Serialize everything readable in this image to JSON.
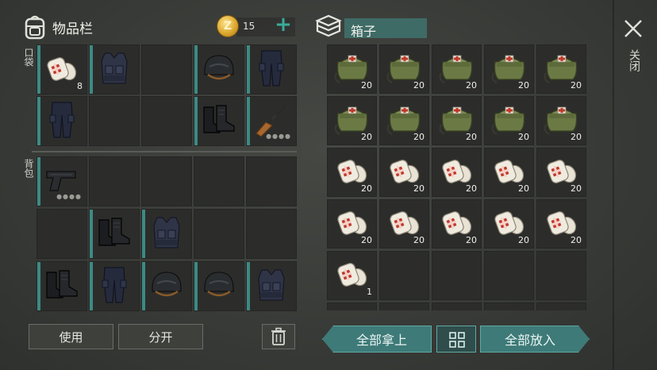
{
  "inventory": {
    "title": "物品栏",
    "coins": "15",
    "coin_symbol": "Z",
    "add_label": "+",
    "pocket_label": "口袋",
    "backpack_label": "背包"
  },
  "box": {
    "title": "箱子"
  },
  "close": {
    "label": "关闭"
  },
  "pocket_slots": [
    {
      "item": "bandage",
      "qty": "8"
    },
    {
      "item": "vest",
      "qty": ""
    },
    {
      "item": "empty",
      "qty": ""
    },
    {
      "item": "helmet",
      "qty": ""
    },
    {
      "item": "pants",
      "qty": ""
    },
    {
      "item": "pants",
      "qty": ""
    },
    {
      "item": "empty",
      "qty": ""
    },
    {
      "item": "empty",
      "qty": ""
    },
    {
      "item": "boots",
      "qty": ""
    },
    {
      "item": "rifle",
      "qty": ""
    }
  ],
  "backpack_slots": [
    {
      "item": "pistol",
      "qty": ""
    },
    {
      "item": "empty",
      "qty": ""
    },
    {
      "item": "empty",
      "qty": ""
    },
    {
      "item": "empty",
      "qty": ""
    },
    {
      "item": "empty",
      "qty": ""
    },
    {
      "item": "empty",
      "qty": ""
    },
    {
      "item": "boots",
      "qty": ""
    },
    {
      "item": "vest",
      "qty": ""
    },
    {
      "item": "empty",
      "qty": ""
    },
    {
      "item": "empty",
      "qty": ""
    },
    {
      "item": "boots",
      "qty": ""
    },
    {
      "item": "pants",
      "qty": ""
    },
    {
      "item": "helmet",
      "qty": ""
    },
    {
      "item": "helmet",
      "qty": ""
    },
    {
      "item": "vest",
      "qty": ""
    }
  ],
  "box_slots": [
    {
      "item": "medkit",
      "qty": "20"
    },
    {
      "item": "medkit",
      "qty": "20"
    },
    {
      "item": "medkit",
      "qty": "20"
    },
    {
      "item": "medkit",
      "qty": "20"
    },
    {
      "item": "medkit",
      "qty": "20"
    },
    {
      "item": "medkit",
      "qty": "20"
    },
    {
      "item": "medkit",
      "qty": "20"
    },
    {
      "item": "medkit",
      "qty": "20"
    },
    {
      "item": "medkit",
      "qty": "20"
    },
    {
      "item": "medkit",
      "qty": "20"
    },
    {
      "item": "bandage",
      "qty": "20"
    },
    {
      "item": "bandage",
      "qty": "20"
    },
    {
      "item": "bandage",
      "qty": "20"
    },
    {
      "item": "bandage",
      "qty": "20"
    },
    {
      "item": "bandage",
      "qty": "20"
    },
    {
      "item": "bandage",
      "qty": "20"
    },
    {
      "item": "bandage",
      "qty": "20"
    },
    {
      "item": "bandage",
      "qty": "20"
    },
    {
      "item": "bandage",
      "qty": "20"
    },
    {
      "item": "bandage",
      "qty": "20"
    },
    {
      "item": "bandage",
      "qty": "1"
    },
    {
      "item": "empty",
      "qty": ""
    },
    {
      "item": "empty",
      "qty": ""
    },
    {
      "item": "empty",
      "qty": ""
    },
    {
      "item": "empty",
      "qty": ""
    },
    {
      "item": "empty",
      "qty": ""
    },
    {
      "item": "empty",
      "qty": ""
    },
    {
      "item": "empty",
      "qty": ""
    },
    {
      "item": "empty",
      "qty": ""
    },
    {
      "item": "empty",
      "qty": ""
    }
  ],
  "buttons": {
    "use": "使用",
    "split": "分开",
    "take_all": "全部拿上",
    "put_all": "全部放入"
  },
  "colors": {
    "accent": "#3d8a84",
    "coin": "#d9a32a",
    "medkit": "#6b7a45"
  }
}
